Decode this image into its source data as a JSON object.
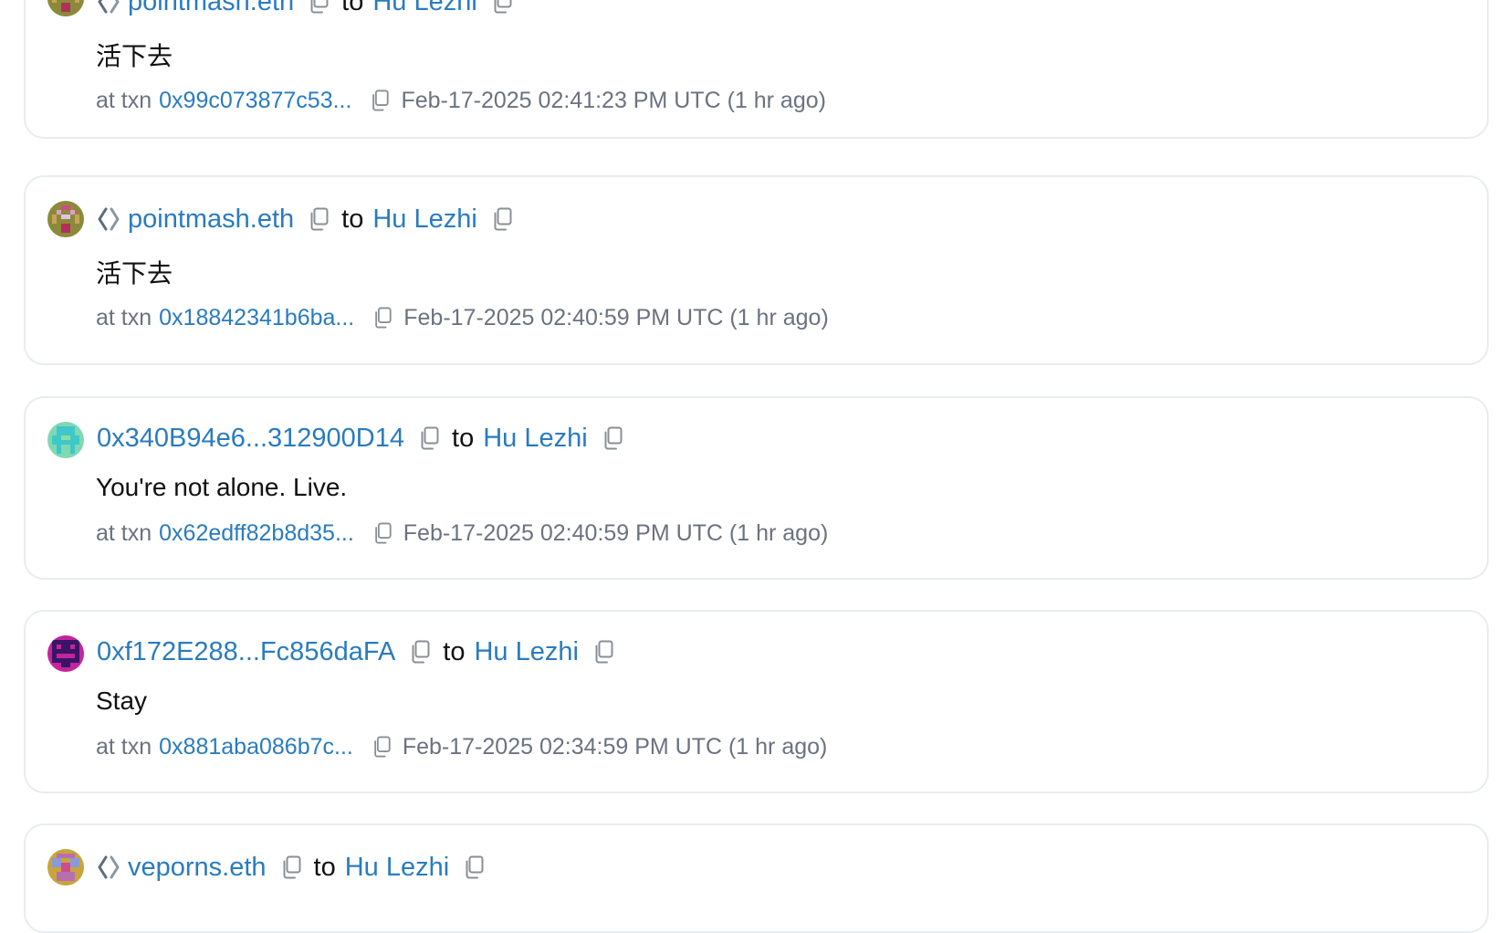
{
  "labels": {
    "to": "to",
    "at_txn": "at txn"
  },
  "colors": {
    "link": "#2a7bbf",
    "meta_text": "#6b7280",
    "card_border": "#e9ecef"
  },
  "comments": [
    {
      "from": "pointmash.eth",
      "from_is_ens": true,
      "to": "Hu Lezhi",
      "message": "活下去",
      "txn": "0x99c073877c53...",
      "timestamp": "Feb-17-2025 02:41:23 PM UTC (1 hr ago)"
    },
    {
      "from": "pointmash.eth",
      "from_is_ens": true,
      "to": "Hu Lezhi",
      "message": "活下去",
      "txn": "0x18842341b6ba...",
      "timestamp": "Feb-17-2025 02:40:59 PM UTC (1 hr ago)"
    },
    {
      "from": "0x340B94e6...312900D14",
      "from_is_ens": false,
      "to": "Hu Lezhi",
      "message": "You're not alone. Live.",
      "txn": "0x62edff82b8d35...",
      "timestamp": "Feb-17-2025 02:40:59 PM UTC (1 hr ago)"
    },
    {
      "from": "0xf172E288...Fc856daFA",
      "from_is_ens": false,
      "to": "Hu Lezhi",
      "message": "Stay",
      "txn": "0x881aba086b7c...",
      "timestamp": "Feb-17-2025 02:34:59 PM UTC (1 hr ago)"
    },
    {
      "from": "veporns.eth",
      "from_is_ens": true,
      "to": "Hu Lezhi"
    }
  ],
  "icons": {
    "copy": "copy-icon",
    "ens": "ens-diamond-icon",
    "avatar": "blockie-avatar"
  }
}
